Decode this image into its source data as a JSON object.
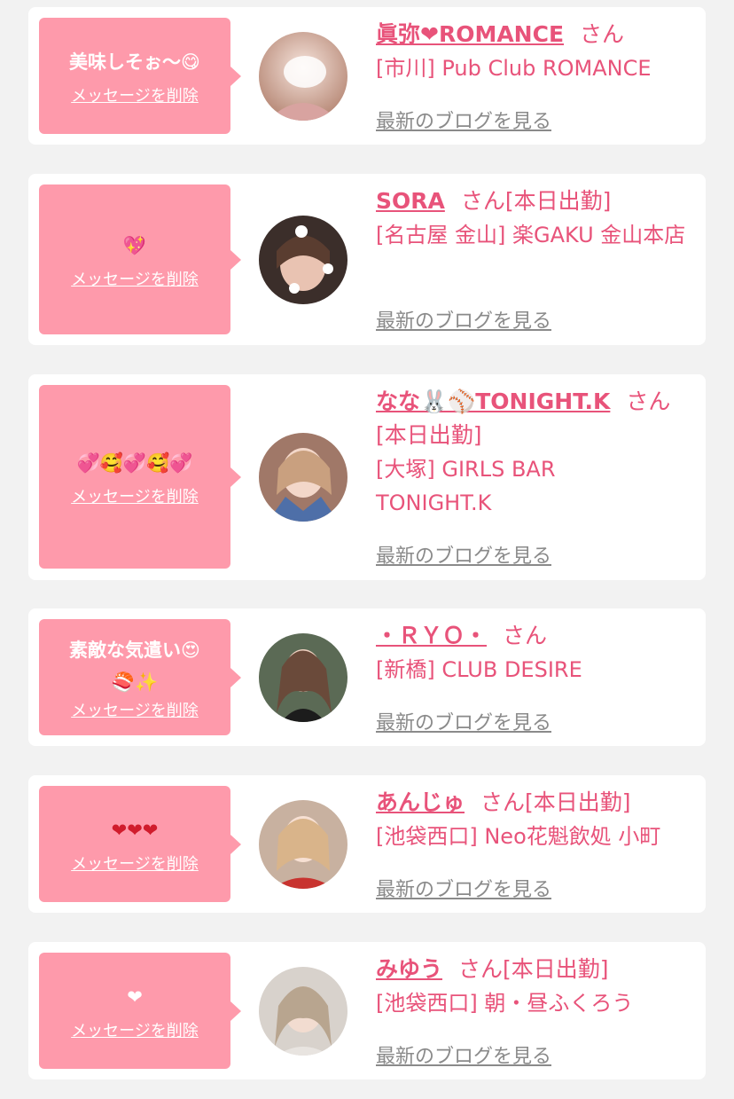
{
  "delete_label": "メッセージを削除",
  "blog_label": "最新のブログを見る",
  "suffix_san": "さん",
  "colors": {
    "bubble": "#fe9aab",
    "accent": "#e8537a",
    "link_gray": "#8a8a8a",
    "background": "#f2f2f2"
  },
  "items": [
    {
      "message": "美味しそぉ〜😋",
      "name": "眞弥❤ROMANCE",
      "status": "",
      "shop": "[市川] Pub Club ROMANCE"
    },
    {
      "message": "💖",
      "name": "SORA",
      "status": "[本日出勤]",
      "shop": "[名古屋 金山] 楽GAKU 金山本店"
    },
    {
      "message": "💞🥰💞🥰💞",
      "name": "なな🐰⚾TONIGHT.K",
      "status": "[本日出勤]",
      "shop": "[大塚] GIRLS BAR TONIGHT.K"
    },
    {
      "message": "素敵な気遣い😍\n🍣✨",
      "name": "・ＲＹＯ・",
      "status": "",
      "shop": "[新橋] CLUB DESIRE"
    },
    {
      "message": "❤❤❤",
      "name": "あんじゅ",
      "status": "[本日出勤]",
      "shop": "[池袋西口] Neo花魁飲処 小町"
    },
    {
      "message": "❤",
      "name": "みゆう",
      "status": "[本日出勤]",
      "shop": "[池袋西口] 朝・昼ふくろう"
    }
  ]
}
